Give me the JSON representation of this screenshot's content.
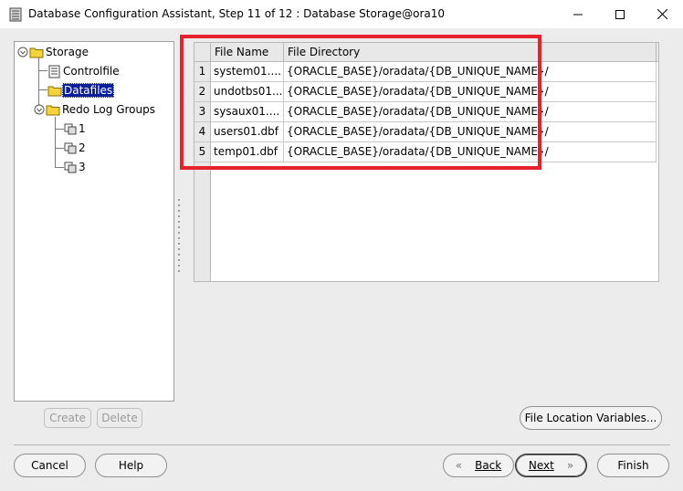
{
  "window": {
    "title": "Database Configuration Assistant, Step 11 of 12 : Database Storage@ora10"
  },
  "tree": {
    "root": "Storage",
    "controlfile": "Controlfile",
    "datafiles": "Datafiles",
    "redo_groups": "Redo Log Groups",
    "redo_items": [
      "1",
      "2",
      "3"
    ]
  },
  "table": {
    "columns": [
      "File Name",
      "File Directory"
    ],
    "rows": [
      {
        "num": "1",
        "name": "system01....",
        "dir": "{ORACLE_BASE}/oradata/{DB_UNIQUE_NAME}/"
      },
      {
        "num": "2",
        "name": "undotbs01...",
        "dir": "{ORACLE_BASE}/oradata/{DB_UNIQUE_NAME}/"
      },
      {
        "num": "3",
        "name": "sysaux01....",
        "dir": "{ORACLE_BASE}/oradata/{DB_UNIQUE_NAME}/"
      },
      {
        "num": "4",
        "name": "users01.dbf",
        "dir": "{ORACLE_BASE}/oradata/{DB_UNIQUE_NAME}/"
      },
      {
        "num": "5",
        "name": "temp01.dbf",
        "dir": "{ORACLE_BASE}/oradata/{DB_UNIQUE_NAME}/"
      }
    ]
  },
  "buttons": {
    "create": "Create",
    "delete": "Delete",
    "file_location": "File Location Variables...",
    "cancel": "Cancel",
    "help": "Help",
    "back": "Back",
    "next": "Next",
    "finish": "Finish"
  },
  "colors": {
    "highlight": "#e8222a",
    "selection": "#0a1e9e"
  }
}
